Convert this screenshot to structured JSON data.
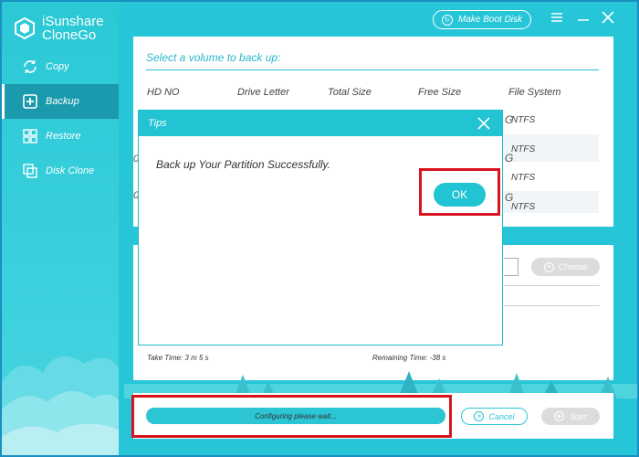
{
  "app": {
    "name_line1": "iSunshare",
    "name_line2": "CloneGo"
  },
  "sidebar": {
    "items": [
      {
        "label": "Copy",
        "icon": "copy-icon"
      },
      {
        "label": "Backup",
        "icon": "backup-icon",
        "active": true
      },
      {
        "label": "Restore",
        "icon": "restore-icon"
      },
      {
        "label": "Disk Clone",
        "icon": "disk-clone-icon"
      }
    ]
  },
  "titlebar": {
    "boot_disk_label": "Make Boot Disk"
  },
  "volume_panel": {
    "title": "Select a volume to back up:",
    "columns": [
      "HD NO",
      "Drive Letter",
      "Total Size",
      "Free Size",
      "File System"
    ],
    "rows": [
      {
        "hd": "0",
        "free_tail": "G",
        "fs": "NTFS"
      },
      {
        "hd": "0",
        "free_tail": "G",
        "fs": "NTFS"
      },
      {
        "hd": "0",
        "free_tail": "G",
        "fs": "NTFS"
      },
      {
        "hd": "0",
        "free_tail": "",
        "fs": "NTFS"
      }
    ]
  },
  "target_panel": {
    "choose_label": "Choose",
    "take_time": "Take Time: 3 m 5 s",
    "remaining_time": "Remaining Time: -38 s"
  },
  "bottom_bar": {
    "progress_text": "Configuring please wait...",
    "cancel_label": "Cancel",
    "start_label": "Start"
  },
  "dialog": {
    "title": "Tips",
    "message": "Back up Your Partition Successfully.",
    "ok_label": "OK"
  },
  "colors": {
    "accent": "#22c3d2",
    "highlight_box": "#d6131f",
    "sidebar_active": "#1a9aac"
  }
}
